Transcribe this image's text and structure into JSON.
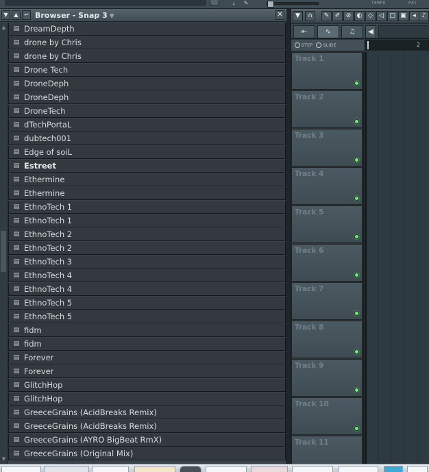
{
  "browser": {
    "title": "Browser - Snap 3",
    "items": [
      {
        "label": "DreamDepth",
        "bold": false
      },
      {
        "label": "drone by Chris",
        "bold": false
      },
      {
        "label": "drone by Chris",
        "bold": false
      },
      {
        "label": "Drone Tech",
        "bold": false
      },
      {
        "label": "DroneDeph",
        "bold": false
      },
      {
        "label": "DroneDeph",
        "bold": false
      },
      {
        "label": "DroneTech",
        "bold": false
      },
      {
        "label": "dTechPortaL",
        "bold": false
      },
      {
        "label": "dubtech001",
        "bold": false
      },
      {
        "label": "Edge of soiL",
        "bold": false
      },
      {
        "label": "Estreet",
        "bold": true
      },
      {
        "label": "Ethermine",
        "bold": false
      },
      {
        "label": "Ethermine",
        "bold": false
      },
      {
        "label": "EthnoTech 1",
        "bold": false
      },
      {
        "label": "EthnoTech 1",
        "bold": false
      },
      {
        "label": "EthnoTech 2",
        "bold": false
      },
      {
        "label": "EthnoTech 2",
        "bold": false
      },
      {
        "label": "EthnoTech 3",
        "bold": false
      },
      {
        "label": "EthnoTech 4",
        "bold": false
      },
      {
        "label": "EthnoTech 4",
        "bold": false
      },
      {
        "label": "EthnoTech 5",
        "bold": false
      },
      {
        "label": "EthnoTech 5",
        "bold": false
      },
      {
        "label": "fidm",
        "bold": false
      },
      {
        "label": "fidm",
        "bold": false
      },
      {
        "label": "Forever",
        "bold": false
      },
      {
        "label": "Forever",
        "bold": false
      },
      {
        "label": "GlitchHop",
        "bold": false
      },
      {
        "label": "GlitchHop",
        "bold": false
      },
      {
        "label": "GreeceGrains (AcidBreaks Remix)",
        "bold": false
      },
      {
        "label": "GreeceGrains (AcidBreaks Remix)",
        "bold": false
      },
      {
        "label": "GreeceGrains (AYRO BigBeat RmX)",
        "bold": false
      },
      {
        "label": "GreeceGrains (Original Mix)",
        "bold": false
      }
    ]
  },
  "topbar": {
    "tempo_label": "TEMPO",
    "pat_label": "PAT"
  },
  "playlist": {
    "modes": {
      "step": "STEP",
      "slide": "SLIDE"
    },
    "ruler_number": "2",
    "tracks": [
      "Track 1",
      "Track 2",
      "Track 3",
      "Track 4",
      "Track 5",
      "Track 6",
      "Track 7",
      "Track 8",
      "Track 9",
      "Track 10",
      "Track 11"
    ]
  },
  "colors": {
    "track_led": "#7fe38a",
    "browser_item_bg": "#34393f",
    "panel_header": "#56646c"
  }
}
